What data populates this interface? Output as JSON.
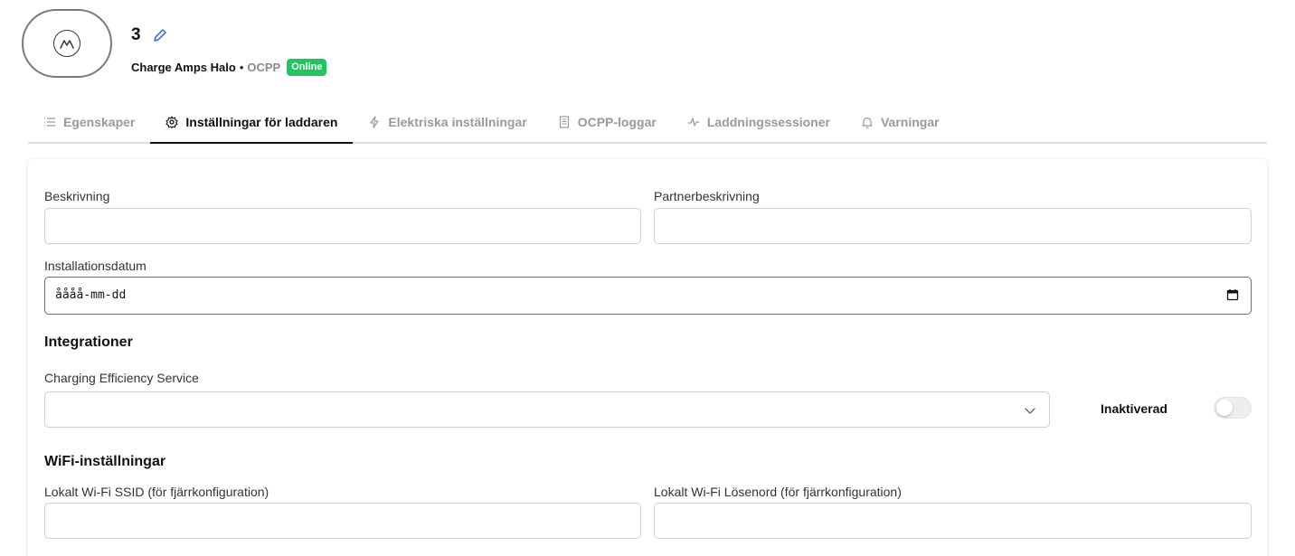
{
  "device": {
    "name": "3",
    "model": "Charge Amps Halo",
    "separator": "•",
    "protocol": "OCPP",
    "status": "Online"
  },
  "tabs": [
    {
      "label": "Egenskaper",
      "icon": "list-icon",
      "active": false
    },
    {
      "label": "Inställningar för laddaren",
      "icon": "gear-icon",
      "active": true
    },
    {
      "label": "Elektriska inställningar",
      "icon": "bolt-icon",
      "active": false
    },
    {
      "label": "OCPP-loggar",
      "icon": "document-icon",
      "active": false
    },
    {
      "label": "Laddningssessioner",
      "icon": "activity-icon",
      "active": false
    },
    {
      "label": "Varningar",
      "icon": "bell-icon",
      "active": false
    }
  ],
  "form": {
    "description_label": "Beskrivning",
    "description_value": "",
    "partner_description_label": "Partnerbeskrivning",
    "partner_description_value": "",
    "install_date_label": "Installationsdatum",
    "install_date_placeholder": "åååå-mm-dd",
    "integrations_title": "Integrationer",
    "ces_label": "Charging Efficiency Service",
    "ces_selected": "",
    "ces_toggle_label": "Inaktiverad",
    "ces_toggle_on": false,
    "wifi_title": "WiFi-inställningar",
    "wifi_ssid_label": "Lokalt Wi-Fi SSID (för fjärrkonfiguration)",
    "wifi_ssid_value": "",
    "wifi_password_label": "Lokalt Wi-Fi Lösenord (för fjärrkonfiguration)",
    "wifi_password_value": ""
  },
  "colors": {
    "status_badge": "#22c55e",
    "edit_icon": "#2563eb",
    "active_tab": "#111111",
    "inactive_tab": "#9a9a9a"
  }
}
